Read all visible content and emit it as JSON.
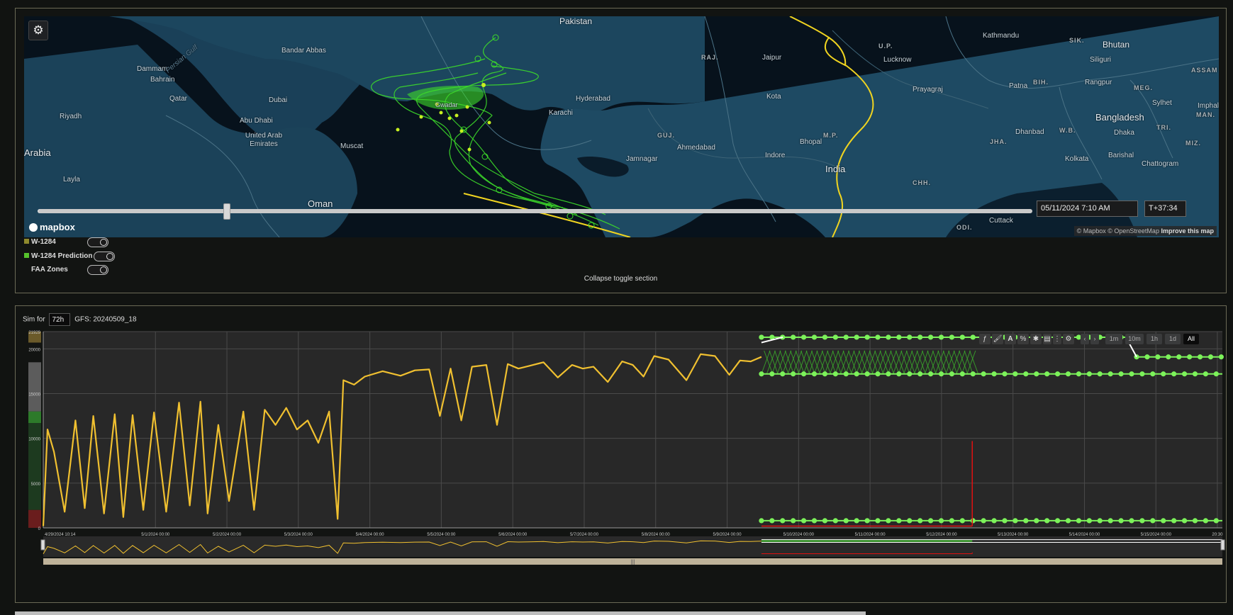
{
  "map": {
    "labels": {
      "pakistan": "Pakistan",
      "bandar_abbas": "Bandar Abbas",
      "dammam": "Dammam",
      "bahrain": "Bahrain",
      "qatar": "Qatar",
      "dubai": "Dubai",
      "riyadh": "Riyadh",
      "abu_dhabi": "Abu Dhabi",
      "uae": "United Arab Emirates",
      "arabia": "Arabia",
      "muscat": "Muscat",
      "layla": "Layla",
      "oman": "Oman",
      "gwadar": "Gwadar",
      "karachi": "Karachi",
      "hyderabad": "Hyderabad",
      "raj": "RAJ.",
      "jaipur": "Jaipur",
      "up": "U.P.",
      "lucknow": "Lucknow",
      "kathmandu": "Kathmandu",
      "sik": "SIK.",
      "bhutan": "Bhutan",
      "siliguri": "Siliguri",
      "assam": "ASSAM",
      "patna": "Patna",
      "bih": "BIH.",
      "rangpur": "Rangpur",
      "meg": "MEG.",
      "sylhet": "Sylhet",
      "imphal": "Imphal",
      "bangladesh": "Bangladesh",
      "man": "MAN.",
      "prayagraj": "Prayagraj",
      "kota": "Kota",
      "guj": "GUJ.",
      "ahmedabad": "Ahmedabad",
      "mp": "M.P.",
      "bhopal": "Bhopal",
      "indore": "Indore",
      "india": "India",
      "jamnagar": "Jamnagar",
      "dhanbad": "Dhanbad",
      "wb": "W.B.",
      "dhaka": "Dhaka",
      "tri": "TRI.",
      "miz": "MIZ.",
      "jha": "JHA.",
      "kolkata": "Kolkata",
      "barishal": "Barishal",
      "chattogram": "Chattogram",
      "chh": "CHH.",
      "cuttack": "Cuttack",
      "odi": "ODI.",
      "persian_gulf": "Persian Gulf"
    },
    "datetime_value": "05/11/2024 7:10 AM",
    "t_offset_value": "T+37:34",
    "logo_text": "mapbox",
    "attribution": "© Mapbox © OpenStreetMap",
    "improve_link": "Improve this map",
    "timeline_position": 0.185
  },
  "layers": [
    {
      "label": "W-1284",
      "color": "#8f8a2d"
    },
    {
      "label": "W-1284 Prediction 1",
      "color": "#56c22c"
    },
    {
      "label": "FAA Zones",
      "color": ""
    }
  ],
  "collapse_label": "Collapse toggle section",
  "sim": {
    "label": "Sim for",
    "hours_value": "72h",
    "gfs_label": "GFS: 20240509_18"
  },
  "toolbar": {
    "tools": [
      "ƒ",
      "🖌",
      "A",
      "%",
      "✱",
      "▤",
      "⋮",
      "⚙"
    ],
    "nav": [
      "‹",
      "›"
    ],
    "zoom": [
      "1m",
      "10m",
      "1h",
      "1d",
      "All"
    ],
    "zoom_active": "All"
  },
  "chart_data": {
    "type": "line",
    "title": "",
    "xlabel": "",
    "ylabel": "",
    "ylim": [
      0,
      21929
    ],
    "y_ticks": [
      "21929",
      "20000",
      "15000",
      "10000",
      "5000",
      "0"
    ],
    "x_ticks": [
      "4/29/2024 10:14",
      "5/1/2024 00:00",
      "5/2/2024 00:00",
      "5/3/2024 00:00",
      "5/4/2024 00:00",
      "5/5/2024 00:00",
      "5/6/2024 00:00",
      "5/7/2024 00:00",
      "5/8/2024 00:00",
      "5/9/2024 00:00",
      "5/10/2024 00:00",
      "5/11/2024 00:00",
      "5/12/2024 00:00",
      "5/13/2024 00:00",
      "5/14/2024 00:00",
      "5/15/2024 00:00",
      "20:30"
    ],
    "x_range_days": [
      0,
      16.5
    ],
    "series": [
      {
        "color": "#f0c030",
        "x": [
          0.0,
          0.06,
          0.15,
          0.3,
          0.45,
          0.58,
          0.7,
          0.85,
          1.0,
          1.12,
          1.25,
          1.4,
          1.55,
          1.72,
          1.9,
          2.05,
          2.2,
          2.3,
          2.45,
          2.6,
          2.8,
          2.95,
          3.1,
          3.25,
          3.4,
          3.55,
          3.7,
          3.85,
          4.0,
          4.12,
          4.2,
          4.35,
          4.5,
          4.75,
          5.0,
          5.2,
          5.4,
          5.55,
          5.7,
          5.85,
          6.0,
          6.2,
          6.35,
          6.5,
          6.65,
          6.8,
          7.0,
          7.2,
          7.4,
          7.55,
          7.7,
          7.9,
          8.1,
          8.25,
          8.4,
          8.55,
          8.75,
          9.0,
          9.2,
          9.4,
          9.6,
          9.75,
          9.9,
          10.05
        ],
        "y": [
          200,
          11000,
          8500,
          1800,
          12000,
          2200,
          12500,
          1600,
          12700,
          1200,
          12600,
          2000,
          12900,
          1800,
          14000,
          2500,
          14100,
          1600,
          11500,
          3000,
          13000,
          2000,
          13200,
          11500,
          13400,
          11000,
          12000,
          9500,
          13000,
          1000,
          16500,
          16000,
          16900,
          17500,
          17000,
          17600,
          17700,
          12500,
          17800,
          12000,
          18000,
          18200,
          11500,
          18300,
          17800,
          18100,
          18500,
          16800,
          18200,
          17800,
          18000,
          16300,
          18600,
          18200,
          16900,
          19200,
          18800,
          16500,
          19400,
          19200,
          17100,
          18700,
          18600,
          19100
        ]
      }
    ],
    "prediction_band": {
      "color": "#3cb82b",
      "x_start": 10.05,
      "x_end": 13.0,
      "y_low": 17200,
      "y_high": 19800
    },
    "prediction_markers": {
      "color": "#7cf25a",
      "levels": [
        21300,
        17200,
        800
      ],
      "x_start": 10.05,
      "x_end": 16.5
    },
    "second_marker_line": {
      "levels": [
        19100
      ],
      "x_start": 15.3,
      "x_end": 16.5
    },
    "red_spike": {
      "color": "#e01010",
      "x": 13.0,
      "y_peak": 9700
    },
    "red_baseline": {
      "color": "#e01010",
      "x_start": 10.05,
      "x_end": 13.0,
      "y": 200
    }
  }
}
